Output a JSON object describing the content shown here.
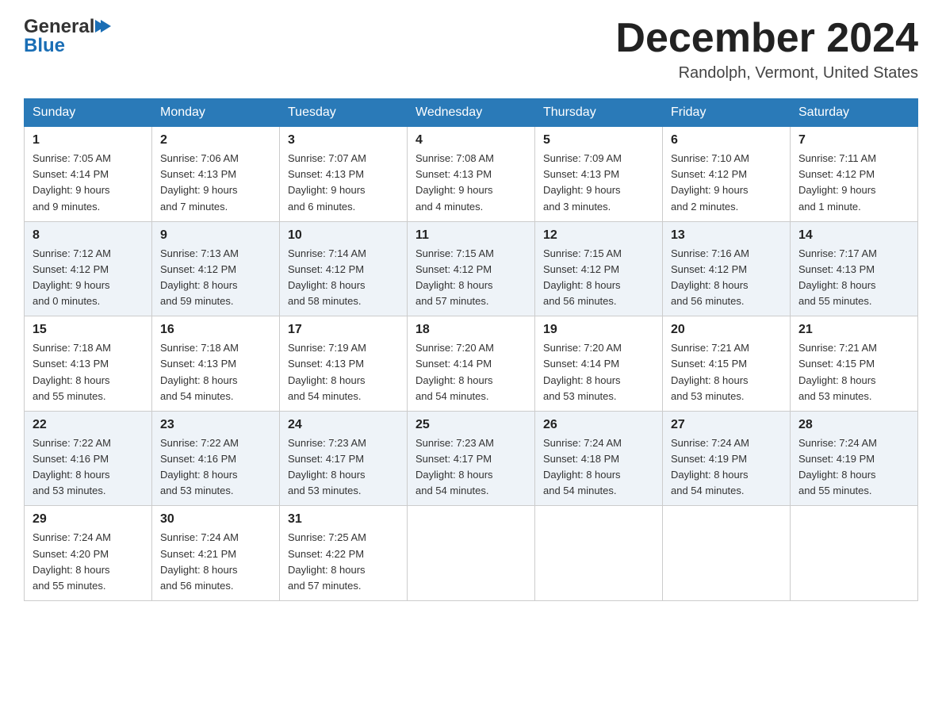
{
  "header": {
    "logo_general": "General",
    "logo_blue": "Blue",
    "month_title": "December 2024",
    "location": "Randolph, Vermont, United States"
  },
  "days_of_week": [
    "Sunday",
    "Monday",
    "Tuesday",
    "Wednesday",
    "Thursday",
    "Friday",
    "Saturday"
  ],
  "weeks": [
    [
      {
        "day": "1",
        "sunrise": "7:05 AM",
        "sunset": "4:14 PM",
        "daylight": "9 hours and 9 minutes."
      },
      {
        "day": "2",
        "sunrise": "7:06 AM",
        "sunset": "4:13 PM",
        "daylight": "9 hours and 7 minutes."
      },
      {
        "day": "3",
        "sunrise": "7:07 AM",
        "sunset": "4:13 PM",
        "daylight": "9 hours and 6 minutes."
      },
      {
        "day": "4",
        "sunrise": "7:08 AM",
        "sunset": "4:13 PM",
        "daylight": "9 hours and 4 minutes."
      },
      {
        "day": "5",
        "sunrise": "7:09 AM",
        "sunset": "4:13 PM",
        "daylight": "9 hours and 3 minutes."
      },
      {
        "day": "6",
        "sunrise": "7:10 AM",
        "sunset": "4:12 PM",
        "daylight": "9 hours and 2 minutes."
      },
      {
        "day": "7",
        "sunrise": "7:11 AM",
        "sunset": "4:12 PM",
        "daylight": "9 hours and 1 minute."
      }
    ],
    [
      {
        "day": "8",
        "sunrise": "7:12 AM",
        "sunset": "4:12 PM",
        "daylight": "9 hours and 0 minutes."
      },
      {
        "day": "9",
        "sunrise": "7:13 AM",
        "sunset": "4:12 PM",
        "daylight": "8 hours and 59 minutes."
      },
      {
        "day": "10",
        "sunrise": "7:14 AM",
        "sunset": "4:12 PM",
        "daylight": "8 hours and 58 minutes."
      },
      {
        "day": "11",
        "sunrise": "7:15 AM",
        "sunset": "4:12 PM",
        "daylight": "8 hours and 57 minutes."
      },
      {
        "day": "12",
        "sunrise": "7:15 AM",
        "sunset": "4:12 PM",
        "daylight": "8 hours and 56 minutes."
      },
      {
        "day": "13",
        "sunrise": "7:16 AM",
        "sunset": "4:12 PM",
        "daylight": "8 hours and 56 minutes."
      },
      {
        "day": "14",
        "sunrise": "7:17 AM",
        "sunset": "4:13 PM",
        "daylight": "8 hours and 55 minutes."
      }
    ],
    [
      {
        "day": "15",
        "sunrise": "7:18 AM",
        "sunset": "4:13 PM",
        "daylight": "8 hours and 55 minutes."
      },
      {
        "day": "16",
        "sunrise": "7:18 AM",
        "sunset": "4:13 PM",
        "daylight": "8 hours and 54 minutes."
      },
      {
        "day": "17",
        "sunrise": "7:19 AM",
        "sunset": "4:13 PM",
        "daylight": "8 hours and 54 minutes."
      },
      {
        "day": "18",
        "sunrise": "7:20 AM",
        "sunset": "4:14 PM",
        "daylight": "8 hours and 54 minutes."
      },
      {
        "day": "19",
        "sunrise": "7:20 AM",
        "sunset": "4:14 PM",
        "daylight": "8 hours and 53 minutes."
      },
      {
        "day": "20",
        "sunrise": "7:21 AM",
        "sunset": "4:15 PM",
        "daylight": "8 hours and 53 minutes."
      },
      {
        "day": "21",
        "sunrise": "7:21 AM",
        "sunset": "4:15 PM",
        "daylight": "8 hours and 53 minutes."
      }
    ],
    [
      {
        "day": "22",
        "sunrise": "7:22 AM",
        "sunset": "4:16 PM",
        "daylight": "8 hours and 53 minutes."
      },
      {
        "day": "23",
        "sunrise": "7:22 AM",
        "sunset": "4:16 PM",
        "daylight": "8 hours and 53 minutes."
      },
      {
        "day": "24",
        "sunrise": "7:23 AM",
        "sunset": "4:17 PM",
        "daylight": "8 hours and 53 minutes."
      },
      {
        "day": "25",
        "sunrise": "7:23 AM",
        "sunset": "4:17 PM",
        "daylight": "8 hours and 54 minutes."
      },
      {
        "day": "26",
        "sunrise": "7:24 AM",
        "sunset": "4:18 PM",
        "daylight": "8 hours and 54 minutes."
      },
      {
        "day": "27",
        "sunrise": "7:24 AM",
        "sunset": "4:19 PM",
        "daylight": "8 hours and 54 minutes."
      },
      {
        "day": "28",
        "sunrise": "7:24 AM",
        "sunset": "4:19 PM",
        "daylight": "8 hours and 55 minutes."
      }
    ],
    [
      {
        "day": "29",
        "sunrise": "7:24 AM",
        "sunset": "4:20 PM",
        "daylight": "8 hours and 55 minutes."
      },
      {
        "day": "30",
        "sunrise": "7:24 AM",
        "sunset": "4:21 PM",
        "daylight": "8 hours and 56 minutes."
      },
      {
        "day": "31",
        "sunrise": "7:25 AM",
        "sunset": "4:22 PM",
        "daylight": "8 hours and 57 minutes."
      },
      null,
      null,
      null,
      null
    ]
  ],
  "labels": {
    "sunrise": "Sunrise:",
    "sunset": "Sunset:",
    "daylight": "Daylight:"
  }
}
